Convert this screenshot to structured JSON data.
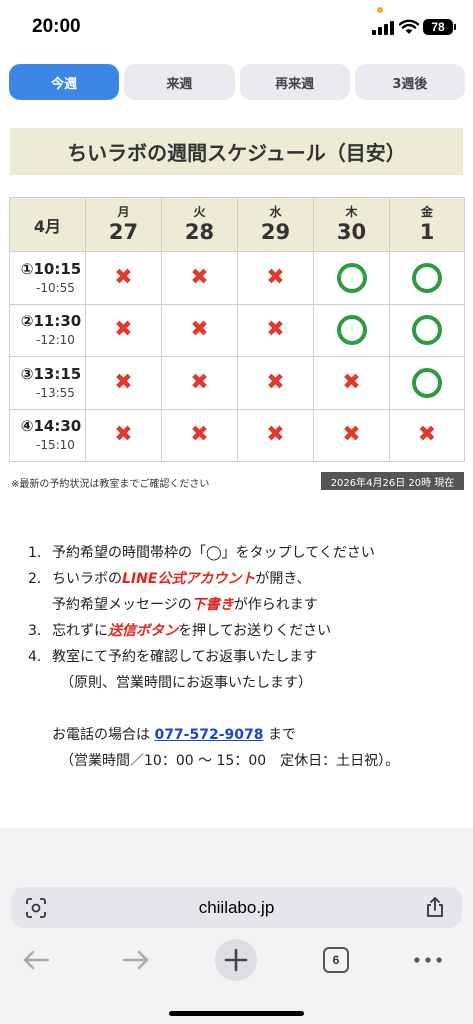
{
  "status_bar": {
    "time": "20:00",
    "battery": "78"
  },
  "tabs": [
    {
      "label": "今週",
      "active": true
    },
    {
      "label": "来週",
      "active": false
    },
    {
      "label": "再来週",
      "active": false
    },
    {
      "label": "3週後",
      "active": false
    }
  ],
  "title": "ちいラボの週間スケジュール（目安）",
  "schedule": {
    "month": "4月",
    "days": [
      {
        "weekday": "月",
        "date": "27"
      },
      {
        "weekday": "火",
        "date": "28"
      },
      {
        "weekday": "水",
        "date": "29"
      },
      {
        "weekday": "木",
        "date": "30"
      },
      {
        "weekday": "金",
        "date": "1"
      }
    ],
    "slots": [
      {
        "start": "①10:15",
        "end": "-10:55",
        "availability": [
          "x",
          "x",
          "x",
          "o",
          "o"
        ]
      },
      {
        "start": "②11:30",
        "end": "-12:10",
        "availability": [
          "x",
          "x",
          "x",
          "o",
          "o"
        ]
      },
      {
        "start": "③13:15",
        "end": "-13:55",
        "availability": [
          "x",
          "x",
          "x",
          "x",
          "o"
        ]
      },
      {
        "start": "④14:30",
        "end": "-15:10",
        "availability": [
          "x",
          "x",
          "x",
          "x",
          "x"
        ]
      }
    ]
  },
  "note_left": "※最新の予約状況は教室までご確認ください",
  "note_right": "2026年4月26日 20時 現在",
  "steps": {
    "s1": {
      "num": "1.",
      "text": "予約希望の時間帯枠の「◯」をタップしてください"
    },
    "s2": {
      "num": "2.",
      "a": "ちいラボの",
      "b": "LINE公式アカウント",
      "c": "が開き、",
      "d": "予約希望メッセージの",
      "e": "下書き",
      "f": "が作られます"
    },
    "s3": {
      "num": "3.",
      "a": "忘れずに",
      "b": "送信ボタン",
      "c": "を押してお送りください"
    },
    "s4": {
      "num": "4.",
      "text": "教室にて予約を確認してお返事いたします",
      "note": "（原則、営業時間にお返事いたします）"
    }
  },
  "contact": {
    "prefix": "お電話の場合は ",
    "phone": "077-572-9078",
    "suffix": " まで",
    "hours": "（営業時間／10：00 〜 15：00　定休日：土日祝）。"
  },
  "browser": {
    "url": "chiilabo.jp",
    "tab_count": "6"
  },
  "colors": {
    "accent": "#3d86e7",
    "available": "#2e9a44",
    "unavailable": "#e03a2e",
    "emphasis": "#e0261f",
    "link": "#1a44d8"
  }
}
